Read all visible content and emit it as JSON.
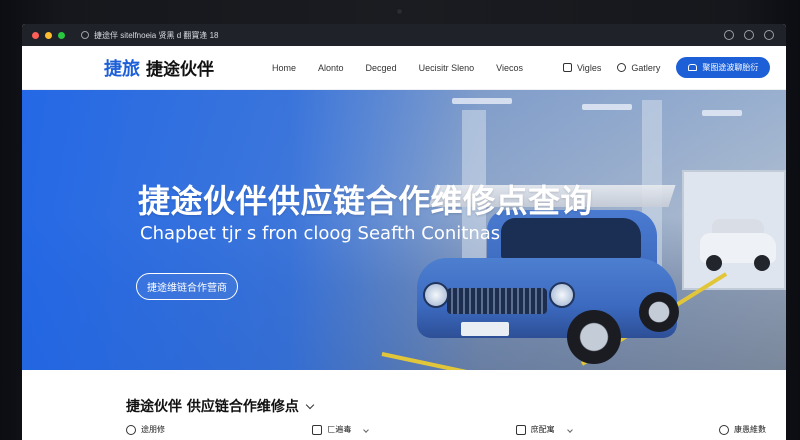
{
  "browser": {
    "address_text": "捷途伴 sitelfnoeia 贤黑 d 翻寶逢 18"
  },
  "header": {
    "brand_mark": "捷旅",
    "brand_name": "捷途伙伴",
    "menu": [
      "Home",
      "Alonto",
      "Decged",
      "Uecisitr Sleno",
      "Viecos"
    ],
    "tools": [
      {
        "label": "Vigles",
        "icon": "document-icon"
      },
      {
        "label": "Gatlery",
        "icon": "user-group-icon"
      }
    ],
    "cta_label": "聚图途波聊胎衍"
  },
  "hero": {
    "title": "捷途伙伴供应链合作维修点查询",
    "subtitle": "Chapbet tjr s fron cloog Seafth Conitnas",
    "button_label": "捷途维链合作营商"
  },
  "section": {
    "title": "捷途伙伴 供应链合作维修点",
    "features": [
      {
        "label": "途朋修",
        "icon": "gear-icon"
      },
      {
        "label": "匚遍毒",
        "icon": "chart-icon"
      },
      {
        "label": "庶配寓",
        "icon": "document-icon"
      },
      {
        "label": "康愚維數",
        "icon": "shield-icon"
      }
    ]
  },
  "colors": {
    "brand_blue": "#1d5fd6",
    "hero_blue": "#3567c6",
    "floor_line": "#e2c63a"
  }
}
